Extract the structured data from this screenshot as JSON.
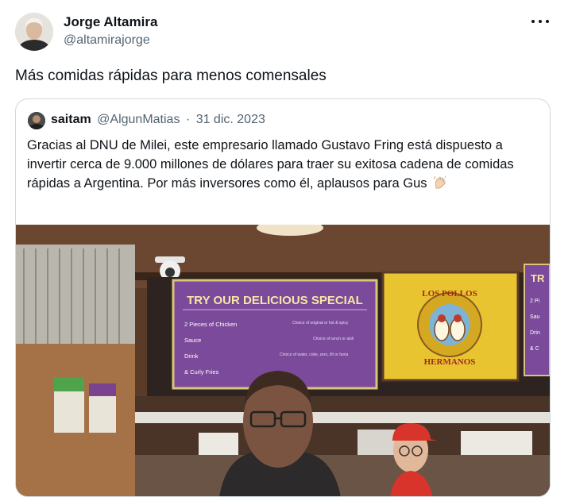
{
  "author": {
    "name": "Jorge Altamira",
    "handle": "@altamirajorge"
  },
  "tweet": {
    "text": "Más comidas rápidas para menos comensales"
  },
  "quoted": {
    "name": "saitam",
    "handle": "@AlgunMatias",
    "separator": "·",
    "date": "31 dic. 2023",
    "text": "Gracias al DNU de Milei, este empresario llamado Gustavo Fring está dispuesto a invertir cerca de 9.000 millones de dólares para traer su exitosa cadena de comidas rápidas a Argentina. Por más inversores como él, aplausos para Gus"
  },
  "menu_sign": {
    "title": "TRY OUR DELICIOUS SPECIAL",
    "items": [
      {
        "name": "2 Pieces of Chicken",
        "note": "Choice of original or hot & spicy"
      },
      {
        "name": "Sauce",
        "note": "Choice of ranch or aioli"
      },
      {
        "name": "Drink",
        "note": "Choice of water, coke, zero, lift or fanta"
      },
      {
        "name": "& Curly Fries",
        "note": ""
      }
    ]
  },
  "logo_sign": {
    "top": "LOS POLLOS",
    "bottom": "HERMANOS"
  },
  "partial_sign": {
    "title": "TR",
    "items": [
      "2 Pi",
      "Sau",
      "Drin",
      "& C"
    ]
  },
  "icons": {
    "more": "more-horizontal-icon",
    "clap": "clapping-hands-icon"
  },
  "colors": {
    "text": "#0f1419",
    "secondary": "#536471",
    "border": "#cfd9de",
    "menu_purple": "#7b4a9a",
    "logo_yellow": "#e9c431"
  }
}
